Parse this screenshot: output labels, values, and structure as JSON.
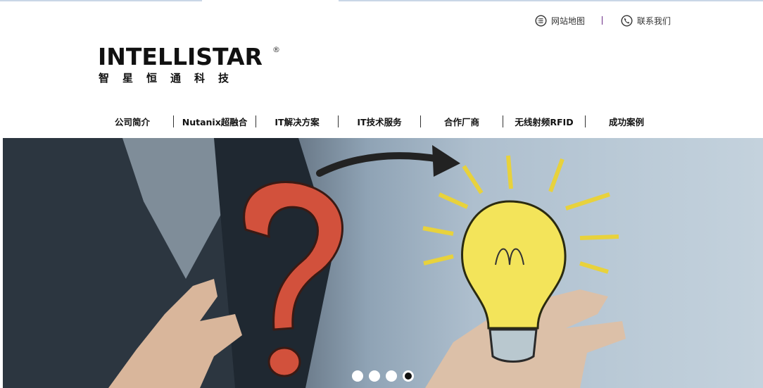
{
  "utility": {
    "sitemap_label": "网站地图",
    "contact_label": "联系我们",
    "sitemap_icon": "list-circle-icon",
    "contact_icon": "phone-circle-icon"
  },
  "logo": {
    "wordmark": "INTELLISTAR",
    "registered": "®",
    "chinese": "智星恒通科技"
  },
  "nav": {
    "items": [
      {
        "label": "公司简介"
      },
      {
        "label": "Nutanix超融合"
      },
      {
        "label": "IT解决方案"
      },
      {
        "label": "IT技术服务"
      },
      {
        "label": "合作厂商"
      },
      {
        "label": "无线射频RFID"
      },
      {
        "label": "成功案例"
      }
    ]
  },
  "banner": {
    "slides_total": 4,
    "active_slide": 4
  },
  "colors": {
    "separator_purple": "#6a2b86",
    "top_rule": "#c9d6e6"
  }
}
